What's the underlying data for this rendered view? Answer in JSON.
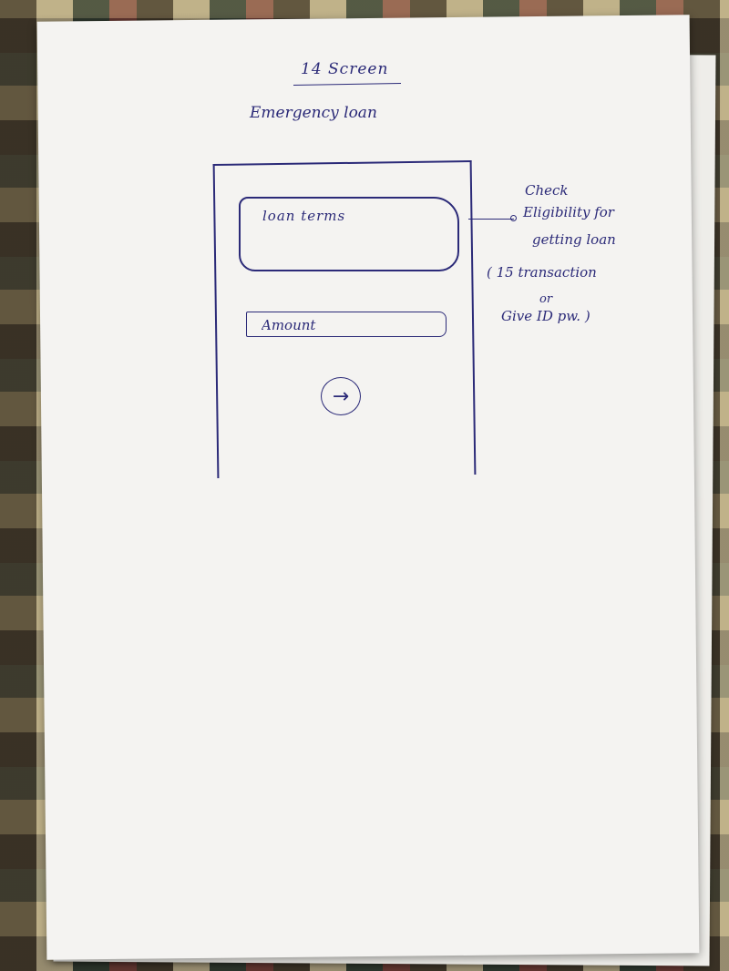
{
  "sketch": {
    "title": "14 Screen",
    "subtitle": "Emergency loan"
  },
  "phone": {
    "loan_terms_label": "loan terms",
    "amount_placeholder": "Amount",
    "next_icon": "arrow-right-icon",
    "next_glyph": "→"
  },
  "annotation": {
    "lines": [
      "Check",
      "Eligibility for",
      "getting loan",
      "( 15 transaction",
      "or",
      "Give ID pw. )"
    ]
  },
  "colors": {
    "ink": "#2b2a78",
    "paper": "#f4f3f1"
  }
}
